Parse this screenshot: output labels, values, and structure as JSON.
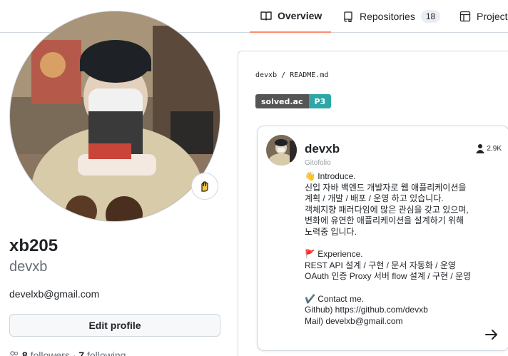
{
  "nav": {
    "overview": "Overview",
    "repositories": "Repositories",
    "repositories_count": "18",
    "projects": "Project"
  },
  "profile": {
    "fullname": "xb205",
    "username": "devxb",
    "email": "develxb@gmail.com",
    "edit_label": "Edit profile",
    "followers_count": "8",
    "followers_label": "followers",
    "following_count": "7",
    "following_label": "following",
    "status_icon": "hand-emoji-icon"
  },
  "readme": {
    "path": "devxb / README.md",
    "badge_left": "solved.ac",
    "badge_right": "P3",
    "badge_right_color": "#2ea6a6"
  },
  "gitofolio": {
    "name": "devxb",
    "subtitle": "Gitofolio",
    "followers": "2.9K",
    "intro_title": "👋 Introduce.",
    "intro_lines": [
      "신입 자바 백엔드 개발자로 웹 애플리케이션을",
      "계획 / 개발 / 배포 / 운영 하고 있습니다.",
      "객체지향 패러다임에 많은 관심을 갖고 있으며,",
      "변화에 유연한 애플리케이션을 설계하기 위해",
      "노력중 입니다."
    ],
    "experience_title": "🚩 Experience.",
    "experience_lines": [
      "REST API 설계 / 구현 / 문서 자동화 / 운영",
      "OAuth 인증 Proxy 서버 flow 설계 / 구현 / 운영"
    ],
    "contact_title": "✔️ Contact me.",
    "contact_lines": [
      "Github) https://github.com/devxb",
      "Mail) develxb@gmail.com"
    ]
  },
  "colors": {
    "accent_underline": "#fd8c73",
    "border": "#d0d7de",
    "muted": "#656d76"
  }
}
